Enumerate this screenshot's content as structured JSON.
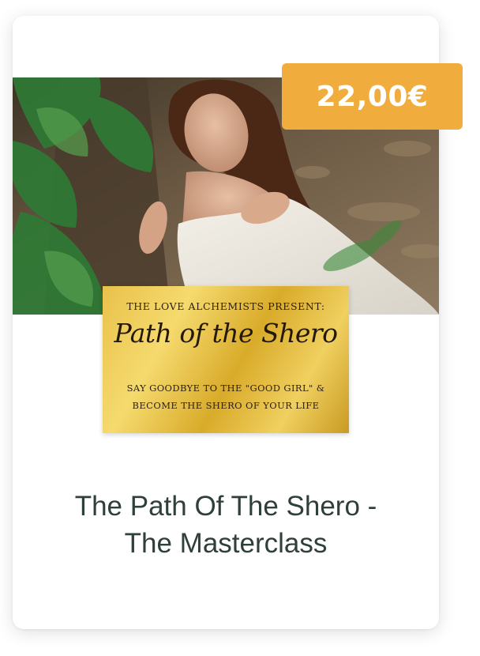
{
  "product": {
    "price": "22,00€",
    "title_line1": "The Path Of The Shero -",
    "title_line2": "The Masterclass"
  },
  "cover": {
    "presenter": "The Love Alchemists Present:",
    "script_title": "Path of the Shero",
    "tagline_line1": "Say goodbye to the \"good girl\" &",
    "tagline_line2": "become the shero of your life"
  },
  "colors": {
    "price_badge": "#f1ac3e",
    "title_text": "#2f3f3a",
    "gold": "#e3b842"
  }
}
